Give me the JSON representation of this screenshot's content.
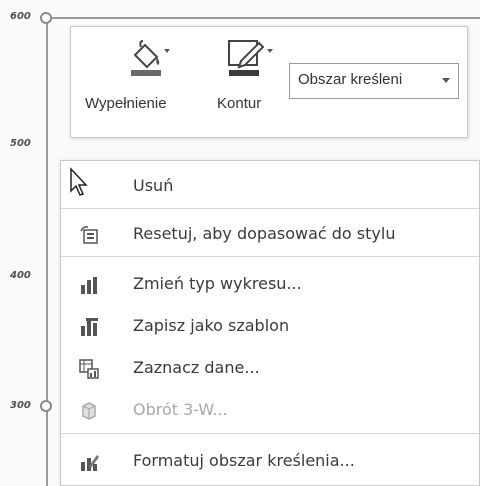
{
  "axis": {
    "ticks": [
      "600",
      "500",
      "400",
      "300"
    ]
  },
  "toolbar": {
    "fill_label": "Wypełnienie",
    "outline_label": "Kontur",
    "element_dropdown": "Obszar kreśleni"
  },
  "menu": {
    "items": [
      {
        "label": "Usuń",
        "icon": "no-icon",
        "enabled": true
      },
      {
        "label": "Resetuj, aby dopasować do stylu",
        "icon": "reset-style-icon",
        "enabled": true
      },
      {
        "label": "Zmień typ wykresu...",
        "icon": "bar-chart-icon",
        "enabled": true
      },
      {
        "label": "Zapisz jako szablon",
        "icon": "save-template-icon",
        "enabled": true
      },
      {
        "label": "Zaznacz dane...",
        "icon": "select-data-icon",
        "enabled": true
      },
      {
        "label": "Obrót 3-W...",
        "icon": "cube-icon",
        "enabled": false
      },
      {
        "label": "Formatuj obszar kreślenia...",
        "icon": "format-area-icon",
        "enabled": true
      }
    ]
  },
  "colors": {
    "axis": "#9a9a9a",
    "text": "#3a3a3a",
    "disabled_text": "#a8a8a8"
  }
}
